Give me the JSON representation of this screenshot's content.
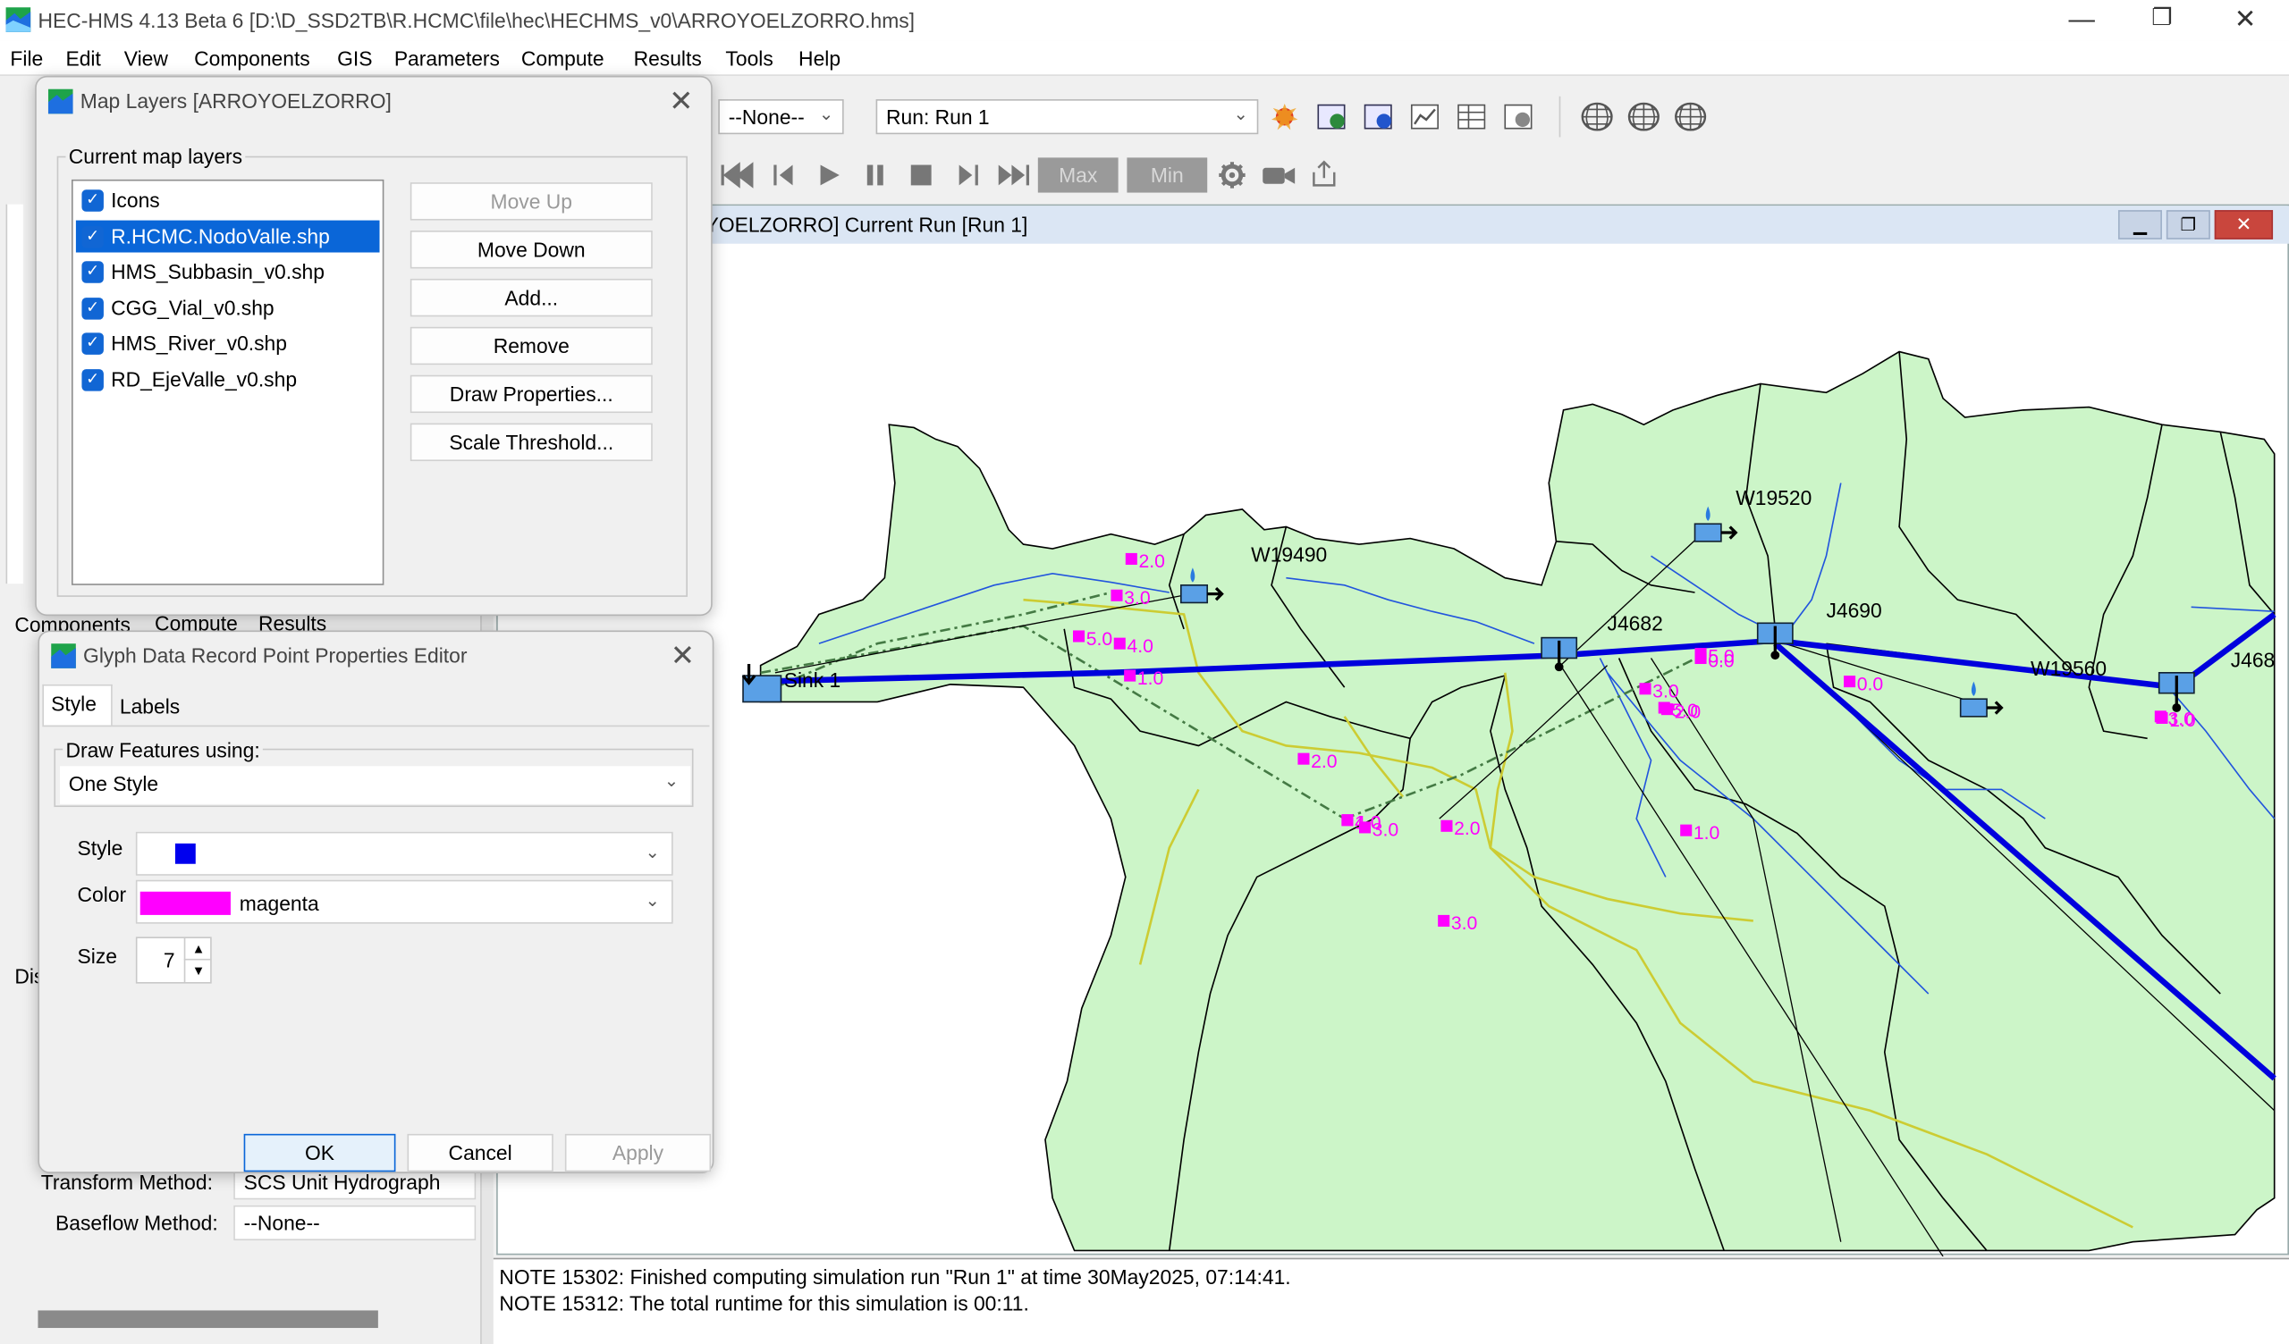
{
  "window": {
    "title": "HEC-HMS 4.13 Beta 6 [D:\\D_SSD2TB\\R.HCMC\\file\\hec\\HECHMS_v0\\ARROYOELZORRO.hms]",
    "minimize": "—",
    "restore": "❐",
    "close": "✕"
  },
  "menu": [
    "File",
    "Edit",
    "View",
    "Components",
    "GIS",
    "Parameters",
    "Compute",
    "Results",
    "Tools",
    "Help"
  ],
  "toolbar": {
    "none_combo": "--None--",
    "run_combo": "Run: Run 1",
    "max_label": "Max",
    "min_label": "Min"
  },
  "map_window": {
    "title": "YOELZORRO] Current Run [Run 1]",
    "labels": {
      "w19490": "W19490",
      "w19520": "W19520",
      "w19560": "W19560",
      "j4682": "J4682",
      "j4690": "J4690",
      "j468": "J468",
      "sink": "Sink 1"
    },
    "points": [
      "2.0",
      "3.0",
      "5.0",
      "4.0",
      "1.0",
      "2.0",
      "1.0",
      "5.0",
      "3.0",
      "2.0",
      "1.0",
      "0.0",
      "5.0",
      "3.0",
      "3.0",
      "2.0",
      "3.0",
      "4.0",
      "1.0",
      "0.0"
    ]
  },
  "notes": [
    "NOTE 15302:  Finished computing simulation run \"Run 1\" at time 30May2025, 07:14:41.",
    "NOTE 15312:  The total runtime for this simulation is 00:11."
  ],
  "left_panel": {
    "tabs": [
      "Components",
      "Compute",
      "Results"
    ],
    "dis_label": "Dis",
    "transform_label": "Transform Method:",
    "transform_value": "SCS Unit Hydrograph",
    "baseflow_label": "Baseflow Method:",
    "baseflow_value": "--None--"
  },
  "map_layers_dialog": {
    "title": "Map Layers [ARROYOELZORRO]",
    "group_label": "Current map layers",
    "layers": [
      {
        "name": "Icons",
        "checked": true,
        "selected": false
      },
      {
        "name": "R.HCMC.NodoValle.shp",
        "checked": true,
        "selected": true
      },
      {
        "name": "HMS_Subbasin_v0.shp",
        "checked": true,
        "selected": false
      },
      {
        "name": "CGG_Vial_v0.shp",
        "checked": true,
        "selected": false
      },
      {
        "name": "HMS_River_v0.shp",
        "checked": true,
        "selected": false
      },
      {
        "name": "RD_EjeValle_v0.shp",
        "checked": true,
        "selected": false
      }
    ],
    "buttons": {
      "move_up": "Move Up",
      "move_down": "Move Down",
      "add": "Add...",
      "remove": "Remove",
      "draw_properties": "Draw Properties...",
      "scale_threshold": "Scale Threshold..."
    }
  },
  "glyph_dialog": {
    "title": "Glyph Data Record Point Properties Editor",
    "tabs": [
      "Style",
      "Labels"
    ],
    "draw_features_label": "Draw Features using:",
    "draw_features_value": "One Style",
    "style_label": "Style",
    "style_swatch_color": "#0000ee",
    "color_label": "Color",
    "color_value": "magenta",
    "color_swatch": "#ff00ff",
    "size_label": "Size",
    "size_value": "7",
    "ok": "OK",
    "cancel": "Cancel",
    "apply": "Apply"
  },
  "colors": {
    "subbasin_fill": "#ccf5c8",
    "river": "#0000dd",
    "road": "#cccc33",
    "selection": "#0a66d8",
    "magenta": "#ff00ff"
  }
}
